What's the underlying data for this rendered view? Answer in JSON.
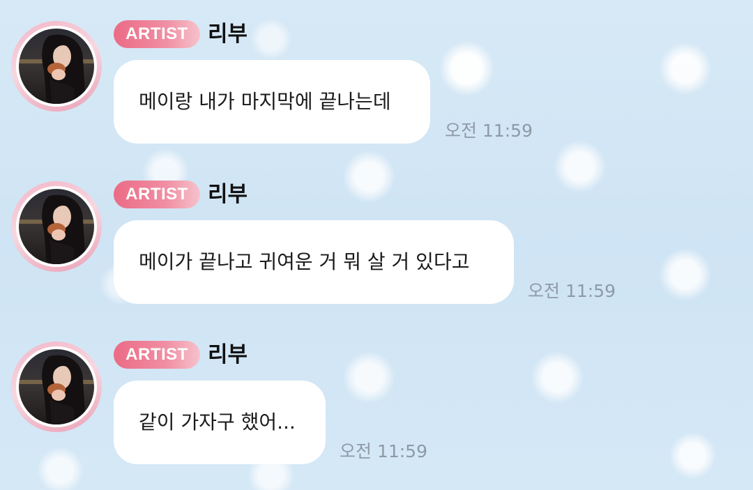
{
  "messages": [
    {
      "badge": "ARTIST",
      "name": "리부",
      "text": "메이랑 내가 마지막에 끝나는데",
      "time": "오전 11:59"
    },
    {
      "badge": "ARTIST",
      "name": "리부",
      "text": "메이가 끝나고 귀여운 거 뭐 살 거 있다고",
      "time": "오전 11:59"
    },
    {
      "badge": "ARTIST",
      "name": "리부",
      "text": "같이 가자구 했어...",
      "time": "오전 11:59"
    }
  ],
  "colors": {
    "badge_gradient_start": "#eb6b86",
    "badge_gradient_end": "#f6c2cc",
    "avatar_ring": "#f3b5c6",
    "bubble": "#ffffff",
    "timestamp": "#8e9aa6",
    "background": "#d3e7f5"
  },
  "icons": {
    "avatar": "profile-photo"
  }
}
